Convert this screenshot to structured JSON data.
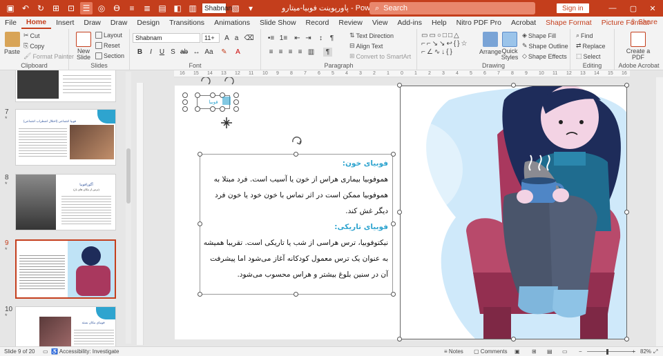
{
  "title_bar": {
    "font_value": "Shabnan",
    "document_title": "پاورپوینت فوبیا-میتارو",
    "app_name": "PowerPoint",
    "search_placeholder": "Search",
    "signin_label": "Sign in",
    "brand_color": "#c43e1c"
  },
  "tabs": [
    "File",
    "Home",
    "Insert",
    "Draw",
    "Draw",
    "Design",
    "Transitions",
    "Animations",
    "Slide Show",
    "Record",
    "Review",
    "View",
    "Add-ins",
    "Help",
    "Nitro PDF Pro",
    "Acrobat",
    "Shape Format",
    "Picture Format"
  ],
  "active_tab": "Home",
  "share_label": "Share",
  "ribbon": {
    "clipboard": {
      "label": "Clipboard",
      "paste": "Paste",
      "cut": "Cut",
      "copy": "Copy",
      "format_painter": "Format Painter"
    },
    "slides": {
      "label": "Slides",
      "new_slide": "New Slide",
      "layout": "Layout",
      "reset": "Reset",
      "section": "Section"
    },
    "font": {
      "label": "Font",
      "family": "Shabnam",
      "size": "11+"
    },
    "paragraph": {
      "label": "Paragraph",
      "text_direction": "Text Direction",
      "align_text": "Align Text",
      "convert_smartart": "Convert to SmartArt"
    },
    "drawing": {
      "label": "Drawing",
      "arrange": "Arrange",
      "quick_styles": "Quick Styles",
      "shape_fill": "Shape Fill",
      "shape_outline": "Shape Outline",
      "shape_effects": "Shape Effects"
    },
    "editing": {
      "label": "Editing",
      "find": "Find",
      "replace": "Replace",
      "select": "Select"
    },
    "adobe": {
      "label": "Adobe Acrobat",
      "create_pdf": "Create a PDF"
    }
  },
  "ruler_ticks": [
    "16",
    "15",
    "14",
    "13",
    "12",
    "11",
    "10",
    "9",
    "8",
    "7",
    "6",
    "5",
    "4",
    "3",
    "2",
    "1",
    "0",
    "1",
    "2",
    "3",
    "4",
    "5",
    "6",
    "7",
    "8",
    "9",
    "10",
    "11",
    "12",
    "13",
    "14",
    "15",
    "16"
  ],
  "thumbnails": [
    {
      "number": "7",
      "title": "فوبیا اجتماعی (اختلال اضطراب اجتماعی)"
    },
    {
      "number": "8",
      "title": "آگورافوبیا",
      "subtitle": "(ترس از مکان های باز)"
    },
    {
      "number": "9",
      "title": "",
      "selected": true
    },
    {
      "number": "10",
      "title": "فوبیای مکان بسته"
    }
  ],
  "slide": {
    "label_shape_text": "فوبیا",
    "heading1": "فوبیای خون:",
    "para1": "هموفوبیا بیماری هراس از خون یا آسیب است. فرد مبتلا به هموفوبیا ممکن است در اثر تماس با خون خود یا خون فرد دیگر غش کند.",
    "heading2": "فوبیای تاریکی:",
    "para2": "نیکتوفوبیا، ترس هراسی از شب یا تاریکی است. تقریبا همیشه به عنوان یک ترس معمول کودکانه آغاز می‌شود اما پیشرفت آن در سنین بلوغ بیشتر و هراس محسوب می‌شود.",
    "accent_color": "#2ea4cf"
  },
  "status": {
    "slide_of": "Slide 9 of 20",
    "accessibility": "Accessibility: Investigate",
    "notes": "Notes",
    "comments": "Comments",
    "zoom": "82%"
  }
}
